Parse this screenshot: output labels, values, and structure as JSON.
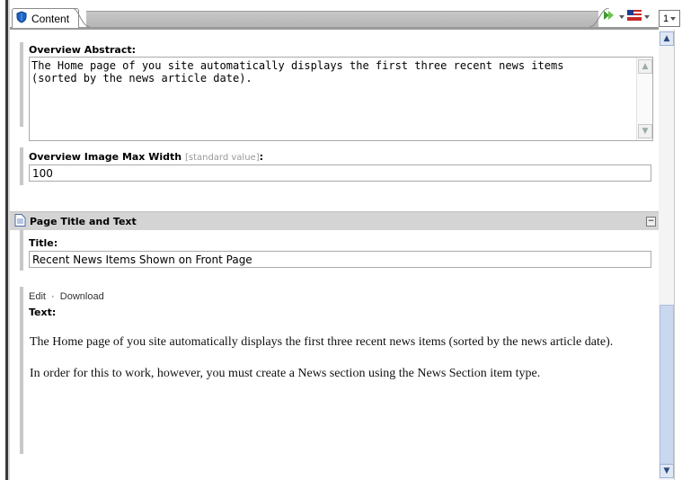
{
  "tab": {
    "label": "Content"
  },
  "version": {
    "value": "1"
  },
  "fields": {
    "overview_abstract": {
      "label": "Overview Abstract:",
      "value": "The Home page of you site automatically displays the first three recent news items\n(sorted by the news article date)."
    },
    "overview_image_max_width": {
      "label": "Overview Image Max Width",
      "std_hint": "[standard value]",
      "colon": ":",
      "value": "100"
    }
  },
  "section": {
    "title": "Page Title and Text"
  },
  "title_field": {
    "label": "Title:",
    "value": "Recent News Items Shown on Front Page"
  },
  "text_field": {
    "edit_label": "Edit",
    "separator": "·",
    "download_label": "Download",
    "label": "Text:",
    "paragraphs": [
      "The Home page of you site automatically displays the first three recent news items (sorted by the news article date).",
      "In order for this to work, however, you must create a News section using the News Section item type."
    ]
  }
}
